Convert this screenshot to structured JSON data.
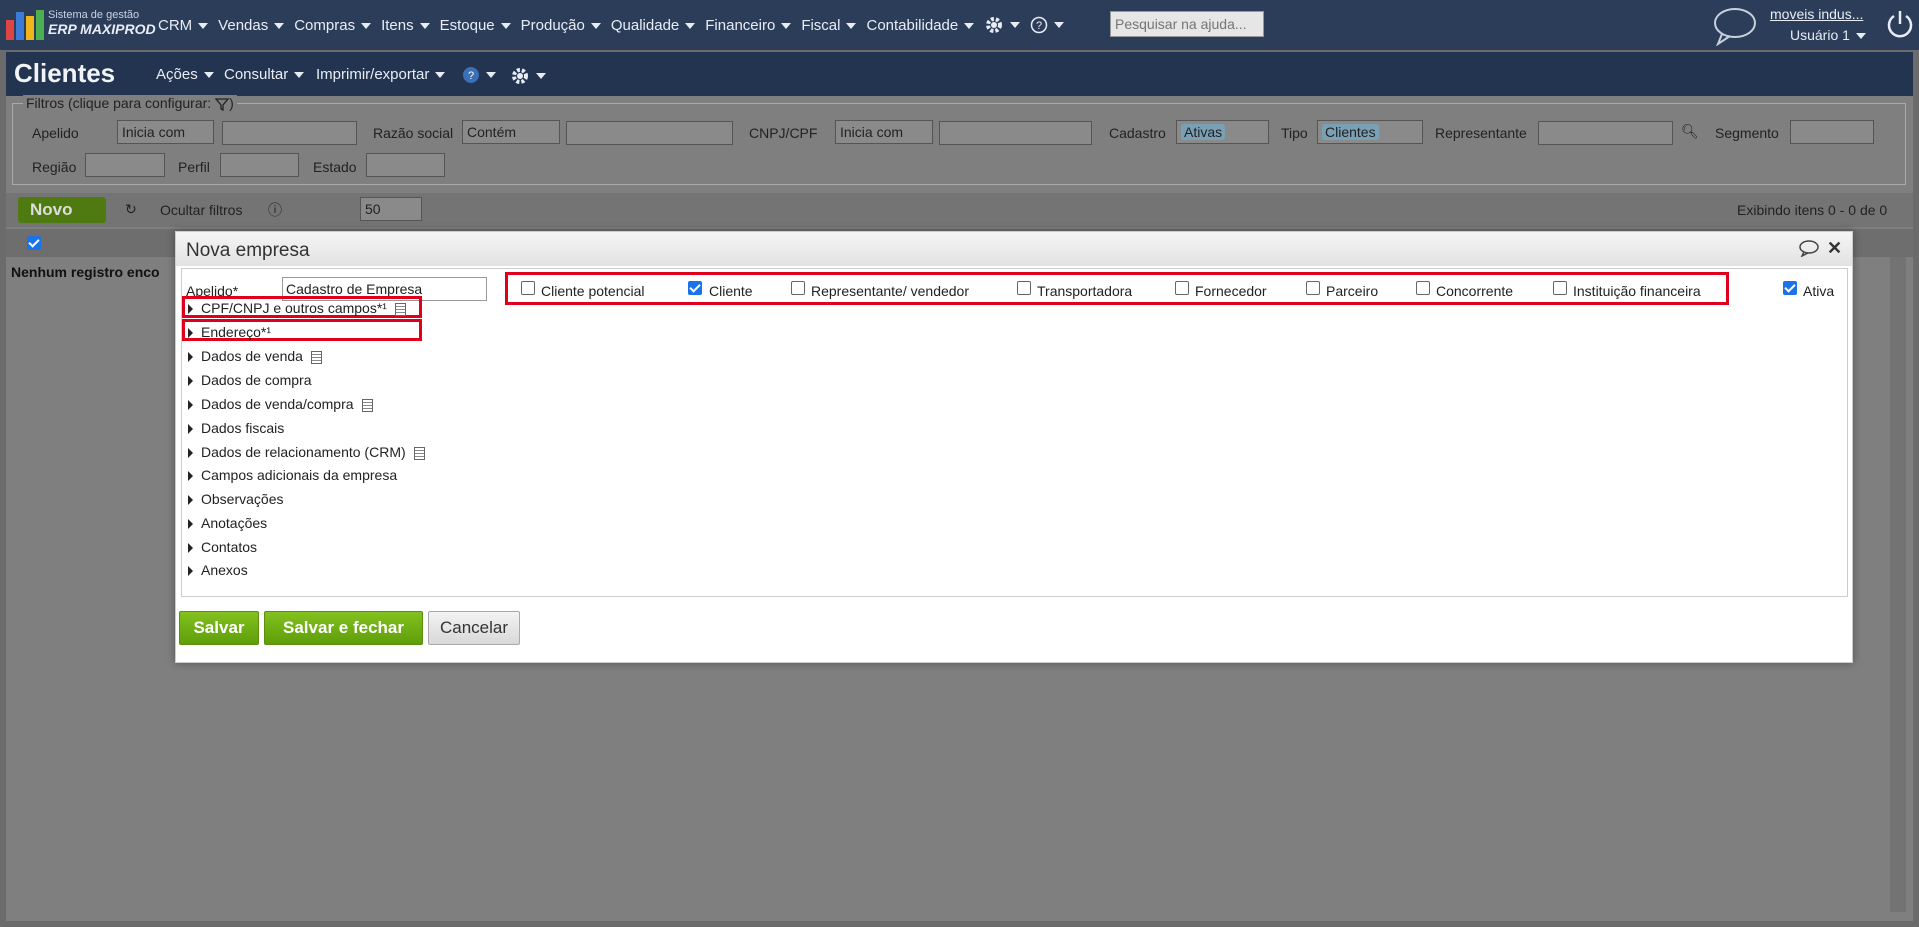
{
  "topbar": {
    "brand_line1": "Sistema de gestão",
    "brand_line2": "ERP MAXIPROD",
    "menu": [
      {
        "label": "CRM"
      },
      {
        "label": "Vendas"
      },
      {
        "label": "Compras"
      },
      {
        "label": "Itens"
      },
      {
        "label": "Estoque"
      },
      {
        "label": "Produção"
      },
      {
        "label": "Qualidade"
      },
      {
        "label": "Financeiro"
      },
      {
        "label": "Fiscal"
      },
      {
        "label": "Contabilidade"
      }
    ],
    "help_placeholder": "Pesquisar na ajuda...",
    "company_link": "moveis indus...",
    "user": "Usuário 1"
  },
  "page": {
    "title": "Clientes",
    "menu": {
      "actions": "Ações",
      "consult": "Consultar",
      "print": "Imprimir/exportar"
    }
  },
  "filters": {
    "legend": "Filtros (clique para configurar:",
    "legend_end": ")",
    "apelido_label": "Apelido",
    "apelido_mode": "Inicia com",
    "razao_label": "Razão social",
    "razao_mode": "Contém",
    "cnpj_label": "CNPJ/CPF",
    "cnpj_mode": "Inicia com",
    "cadastro_label": "Cadastro",
    "cadastro_chip": "Ativas",
    "tipo_label": "Tipo",
    "tipo_chip": "Clientes",
    "representante_label": "Representante",
    "segmento_label": "Segmento",
    "regiao_label": "Região",
    "perfil_label": "Perfil",
    "estado_label": "Estado"
  },
  "toolbar": {
    "novo": "Novo",
    "hide_filters": "Ocultar filtros",
    "page_size": "50",
    "showing": "Exibindo itens 0 - 0 de 0"
  },
  "grid": {
    "empty": "Nenhum registro enco"
  },
  "modal": {
    "title": "Nova empresa",
    "apelido_label": "Apelido*",
    "apelido_value": "Cadastro de Empresa",
    "types": [
      {
        "label": "Cliente potencial",
        "checked": false
      },
      {
        "label": "Cliente",
        "checked": true
      },
      {
        "label": "Representante/ vendedor",
        "checked": false
      },
      {
        "label": "Transportadora",
        "checked": false
      },
      {
        "label": "Fornecedor",
        "checked": false
      },
      {
        "label": "Parceiro",
        "checked": false
      },
      {
        "label": "Concorrente",
        "checked": false
      },
      {
        "label": "Instituição financeira",
        "checked": false
      }
    ],
    "ativa": {
      "label": "Ativa",
      "checked": true
    },
    "sections": [
      {
        "label": "CPF/CNPJ e outros campos*¹",
        "doc": true
      },
      {
        "label": "Endereço*¹",
        "doc": false
      },
      {
        "label": "Dados de venda",
        "doc": true
      },
      {
        "label": "Dados de compra",
        "doc": false
      },
      {
        "label": "Dados de venda/compra",
        "doc": true
      },
      {
        "label": "Dados fiscais",
        "doc": false
      },
      {
        "label": "Dados de relacionamento (CRM)",
        "doc": true
      },
      {
        "label": "Campos adicionais da empresa",
        "doc": false
      },
      {
        "label": "Observações",
        "doc": false
      },
      {
        "label": "Anotações",
        "doc": false
      },
      {
        "label": "Contatos",
        "doc": false
      },
      {
        "label": "Anexos",
        "doc": false
      }
    ],
    "buttons": {
      "save": "Salvar",
      "save_close": "Salvar e fechar",
      "cancel": "Cancelar"
    }
  },
  "colors": {
    "nav": "#2c3d5a",
    "header": "#22344f",
    "highlight": "#e0001b",
    "green": "#6fae14"
  }
}
